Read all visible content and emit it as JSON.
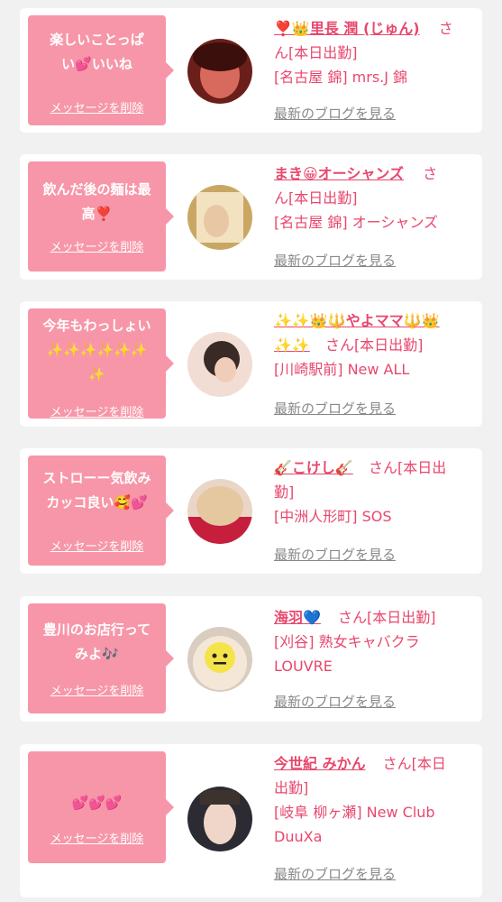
{
  "delete_label": "メッセージを削除",
  "blog_label": "最新のブログを見る",
  "entries": [
    {
      "message_line1": "楽しいことっぱ",
      "message_line2": "い💕いいね",
      "name": "❣️👑里長 潤 (じゅん)",
      "status_line1": "さ",
      "status_line2": "ん[本日出勤]",
      "shop": "[名古屋 錦] mrs.J 錦",
      "avatar_colors": [
        "#6b1f1a",
        "#d76a5c"
      ]
    },
    {
      "message_line1": "飲んだ後の麺は最",
      "message_line2": "高❣️",
      "name": "まき😀オーシャンズ",
      "status_line1": "さ",
      "status_line2": "ん[本日出勤]",
      "shop": "[名古屋 錦] オーシャンズ",
      "avatar_colors": [
        "#c9a763",
        "#f3e2c0"
      ]
    },
    {
      "message_line1": "今年もわっしょい",
      "message_line2": "✨✨✨✨✨✨",
      "message_line3": "✨",
      "name_line1": "✨✨👑🔱やよママ🔱👑",
      "name_line2": "✨✨",
      "status": "さん[本日出勤]",
      "shop": "[川崎駅前] New ALL",
      "avatar_colors": [
        "#3a2a26",
        "#f1ddd4"
      ]
    },
    {
      "message_line1": "ストローー気飲み",
      "message_line2": "カッコ良い🥰💕",
      "name": "🎸こけし🎸",
      "status_line1": "さん[本日出",
      "status_line2": "勤]",
      "shop": "[中洲人形町] SOS",
      "avatar_colors": [
        "#e9d6c7",
        "#c61f3d"
      ]
    },
    {
      "message_line1": "豊川のお店行って",
      "message_line2": "みよ🎶",
      "name": "海羽💙",
      "status": "さん[本日出勤]",
      "shop_line1": "[刈谷] 熟女キャバクラ",
      "shop_line2": "LOUVRE",
      "avatar_colors": [
        "#d8cdbf",
        "#f4e7d8"
      ]
    },
    {
      "message_line1": "💕💕💕",
      "name": "今世紀 みかん",
      "status_line1": "さん[本日",
      "status_line2": "出勤]",
      "shop_line1": "[岐阜 柳ヶ瀬] New Club",
      "shop_line2": "DuuXa",
      "avatar_colors": [
        "#2c2b33",
        "#f0d6c8"
      ]
    }
  ],
  "colors": {
    "background": "#f1f1f1",
    "card": "#ffffff",
    "bubble": "#f796a8",
    "accent_text": "#e8476d",
    "blog_link": "#888888"
  }
}
